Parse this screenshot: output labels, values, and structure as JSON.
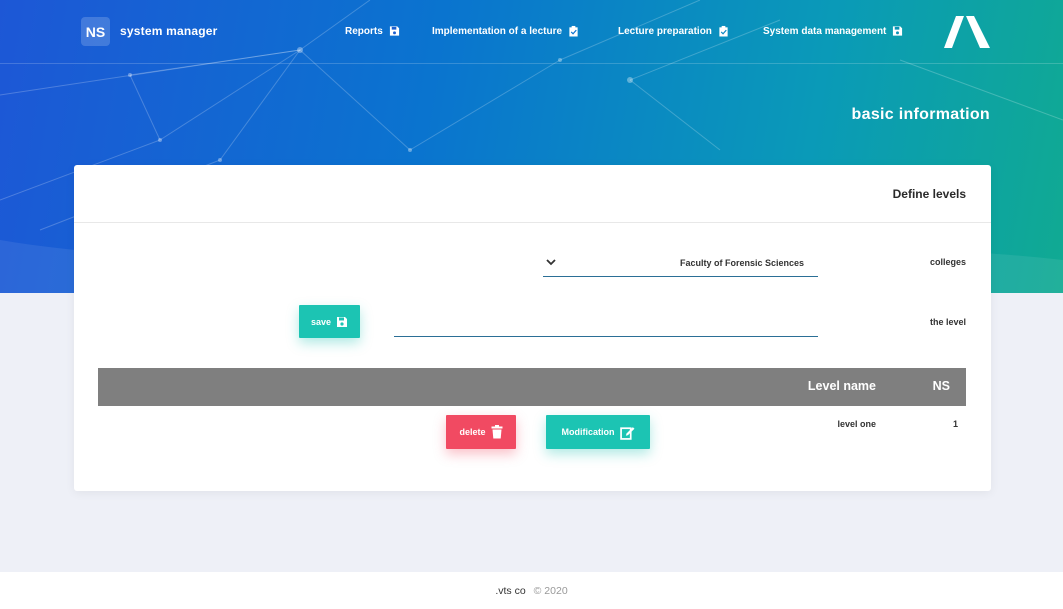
{
  "brand": {
    "badge": "NS",
    "name": "system manager"
  },
  "nav": {
    "items": [
      {
        "label": "Reports",
        "icon": "save-icon"
      },
      {
        "label": "Implementation of a lecture",
        "icon": "clipboard-check-icon"
      },
      {
        "label": "Lecture preparation",
        "icon": "clipboard-check-icon"
      },
      {
        "label": "System data management",
        "icon": "save-icon"
      }
    ]
  },
  "page": {
    "heading": "basic information"
  },
  "card": {
    "title": "Define levels",
    "college_label": "colleges",
    "college_value": "Faculty of Forensic Sciences",
    "level_label": "the level",
    "level_value": "",
    "save_label": "save"
  },
  "table": {
    "headers": {
      "name": "Level name",
      "ns": "NS"
    },
    "rows": [
      {
        "ns": "1",
        "name": "level one",
        "edit_label": "Modification",
        "delete_label": "delete"
      }
    ]
  },
  "footer": {
    "company": ".vts co",
    "year": "© 2020"
  },
  "colors": {
    "teal": "#1cc4b3",
    "red": "#f14a62",
    "table_header": "#7f7f7f",
    "gradient_start": "#1d57d6",
    "gradient_end": "#10aa92"
  }
}
